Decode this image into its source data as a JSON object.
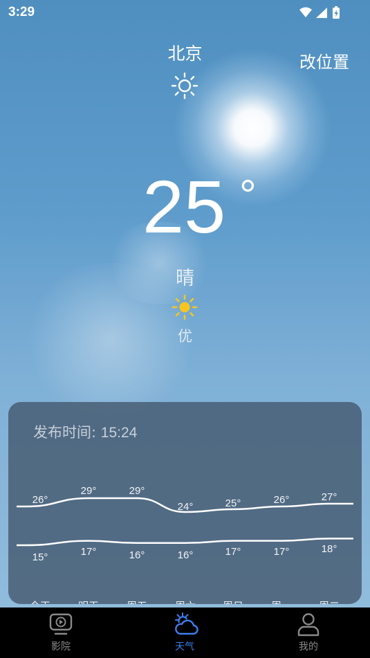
{
  "status_bar": {
    "time": "3:29"
  },
  "header": {
    "city": "北京",
    "change_location": "改位置"
  },
  "current": {
    "temperature": "25",
    "degree_symbol": "°",
    "condition": "晴",
    "air_quality": "优"
  },
  "forecast": {
    "publish_label": "发布时间: ",
    "publish_time": "15:24",
    "highs": [
      "26°",
      "29°",
      "29°",
      "24°",
      "25°",
      "26°",
      "27°"
    ],
    "lows": [
      "15°",
      "17°",
      "16°",
      "16°",
      "17°",
      "17°",
      "18°"
    ],
    "high_values": [
      26,
      29,
      29,
      24,
      25,
      26,
      27
    ],
    "low_values": [
      15,
      17,
      16,
      16,
      17,
      17,
      18
    ],
    "days": [
      "今天",
      "明天",
      "周五",
      "周六",
      "周日",
      "周一",
      "周二"
    ]
  },
  "nav": {
    "items": [
      {
        "label": "影院",
        "icon": "video-play-icon",
        "active": false
      },
      {
        "label": "天气",
        "icon": "weather-cloud-sun-icon",
        "active": true
      },
      {
        "label": "我的",
        "icon": "person-icon",
        "active": false
      }
    ]
  },
  "colors": {
    "accent": "#3d7ff0",
    "nav_inactive": "#8a8a8a",
    "sun_yellow": "#f7c51e",
    "card_bg": "#4a5d72"
  }
}
